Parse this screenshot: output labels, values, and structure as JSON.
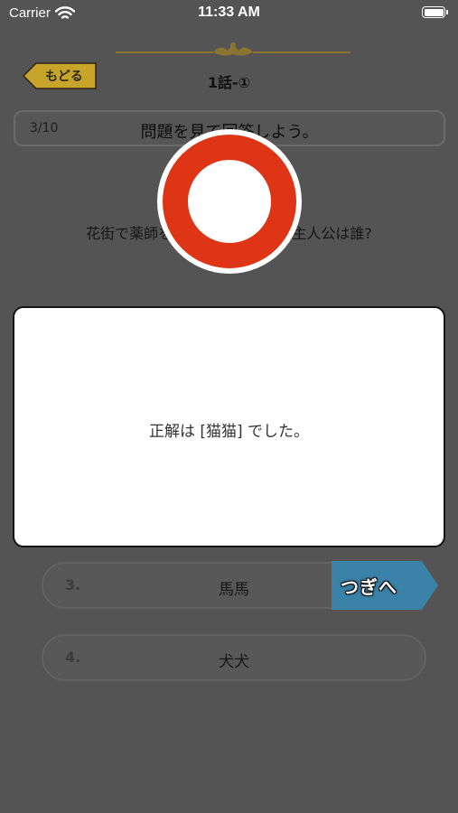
{
  "status_bar": {
    "carrier": "Carrier",
    "time": "11:33 AM"
  },
  "header": {
    "back_label": "もどる",
    "episode_title": "1話-①"
  },
  "progress": {
    "count": "3/10",
    "prompt": "問題を見て回答しよう。"
  },
  "question": {
    "text": "花街で薬師をやっていた,本作の主人公は誰?"
  },
  "options": [
    {
      "number": "3.",
      "text": "馬馬"
    },
    {
      "number": "4.",
      "text": "犬犬"
    }
  ],
  "next_button": {
    "label": "つぎへ"
  },
  "result": {
    "text": "正解は [猫猫] でした。"
  },
  "colors": {
    "mark_red": "#dd3515",
    "next_button": "#3a82a8",
    "back_button": "#c7a52a",
    "ornament": "#8a7430"
  },
  "icons": {
    "correct": "circle-mark-icon"
  }
}
